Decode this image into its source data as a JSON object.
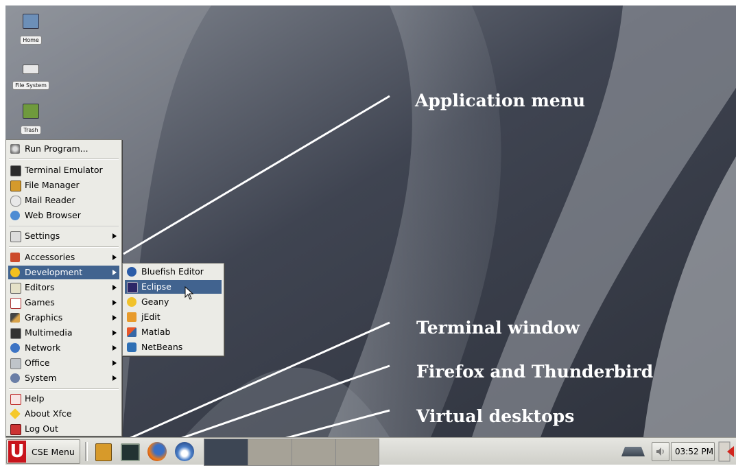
{
  "desktop": {
    "icons": [
      {
        "label": "Home",
        "icon": "home-folder-icon"
      },
      {
        "label": "File System",
        "icon": "drive-icon"
      },
      {
        "label": "Trash",
        "icon": "trash-icon"
      }
    ]
  },
  "menu": {
    "run_program": "Run Program...",
    "items": [
      {
        "label": "Terminal Emulator",
        "icon": "terminal-icon"
      },
      {
        "label": "File Manager",
        "icon": "file-manager-icon"
      },
      {
        "label": "Mail Reader",
        "icon": "mail-icon"
      },
      {
        "label": "Web Browser",
        "icon": "web-browser-icon"
      }
    ],
    "settings": "Settings",
    "categories": [
      {
        "label": "Accessories",
        "icon": "accessories-icon"
      },
      {
        "label": "Development",
        "icon": "development-icon"
      },
      {
        "label": "Editors",
        "icon": "editors-icon"
      },
      {
        "label": "Games",
        "icon": "games-icon"
      },
      {
        "label": "Graphics",
        "icon": "graphics-icon"
      },
      {
        "label": "Multimedia",
        "icon": "multimedia-icon"
      },
      {
        "label": "Network",
        "icon": "network-icon"
      },
      {
        "label": "Office",
        "icon": "office-icon"
      },
      {
        "label": "System",
        "icon": "system-icon"
      }
    ],
    "footer": [
      {
        "label": "Help",
        "icon": "help-icon"
      },
      {
        "label": "About Xfce",
        "icon": "xfce-icon"
      },
      {
        "label": "Log Out",
        "icon": "logout-icon"
      }
    ],
    "selected_category": "Development"
  },
  "submenu": {
    "items": [
      {
        "label": "Bluefish Editor",
        "icon": "bluefish-icon"
      },
      {
        "label": "Eclipse",
        "icon": "eclipse-icon"
      },
      {
        "label": "Geany",
        "icon": "geany-icon"
      },
      {
        "label": "jEdit",
        "icon": "jedit-icon"
      },
      {
        "label": "Matlab",
        "icon": "matlab-icon"
      },
      {
        "label": "NetBeans",
        "icon": "netbeans-icon"
      }
    ],
    "selected": "Eclipse"
  },
  "callouts": {
    "app_menu": "Application menu",
    "terminal": "Terminal window",
    "firefox": "Firefox and Thunderbird",
    "desktops": "Virtual desktops"
  },
  "panel": {
    "menu_label": "CSE Menu",
    "clock": "03:52 PM"
  },
  "colors": {
    "selection": "#41638f",
    "wallpaper": "#4a4f5b",
    "menu_bg": "#ebebe6"
  }
}
